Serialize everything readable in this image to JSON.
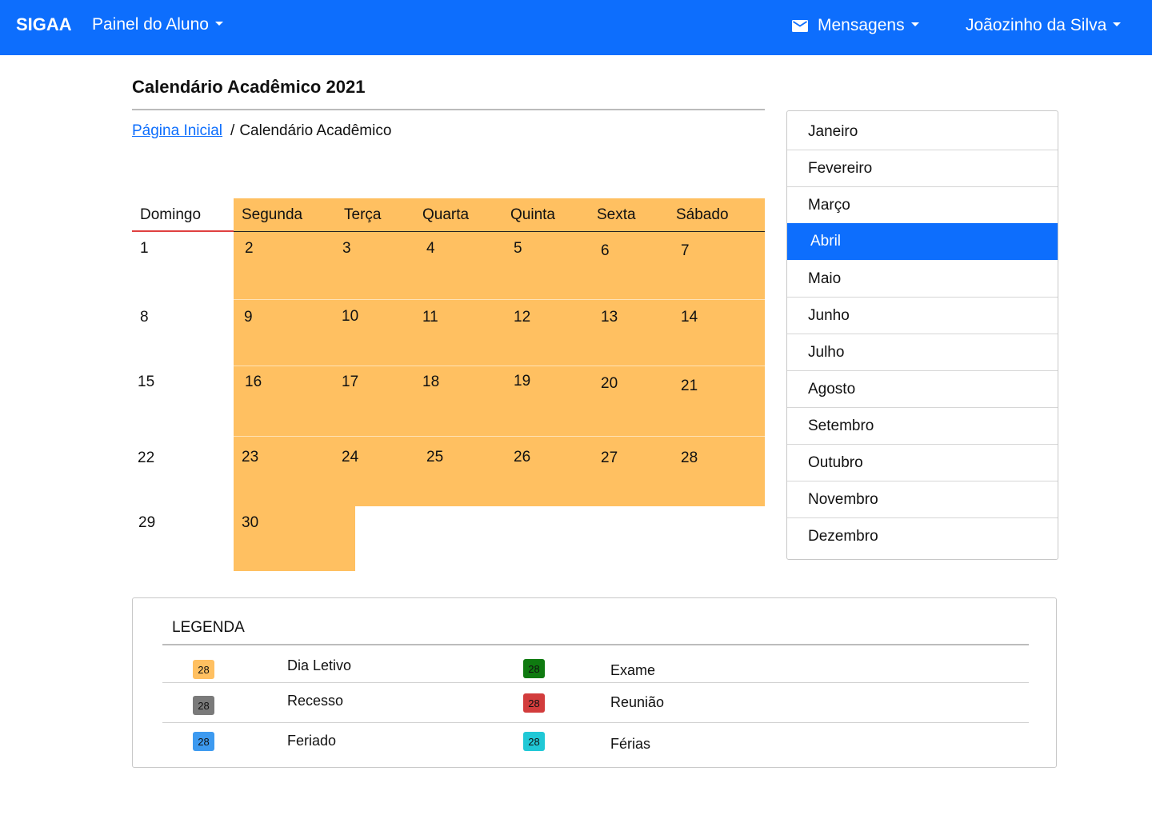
{
  "navbar": {
    "brand": "SIGAA",
    "menu_label": "Painel do Aluno",
    "messages_label": "Mensagens",
    "messages_icon": "envelope-icon",
    "user_name": "Joãozinho da Silva",
    "background_color": "#0d6efd"
  },
  "page": {
    "title": "Calendário Acadêmico 2021",
    "breadcrumb": {
      "home": "Página Inicial",
      "separator": "/",
      "current": "Calendário Acadêmico"
    }
  },
  "calendar": {
    "weekdays": [
      "Domingo",
      "Segunda",
      "Terça",
      "Quarta",
      "Quinta",
      "Sexta",
      "Sábado"
    ],
    "weeks": [
      [
        "1",
        "2",
        "3",
        "4",
        "5",
        "6",
        "7"
      ],
      [
        "8",
        "9",
        "10",
        "11",
        "12",
        "13",
        "14"
      ],
      [
        "15",
        "16",
        "17",
        "18",
        "19",
        "20",
        "21"
      ],
      [
        "22",
        "23",
        "24",
        "25",
        "26",
        "27",
        "28"
      ],
      [
        "29",
        "30"
      ]
    ],
    "school_day_color": "#ffc061"
  },
  "months": {
    "items": [
      "Janeiro",
      "Fevereiro",
      "Março",
      "Abril",
      "Maio",
      "Junho",
      "Julho",
      "Agosto",
      "Setembro",
      "Outubro",
      "Novembro",
      "Dezembro"
    ],
    "active": "Abril"
  },
  "legend": {
    "title": "LEGENDA",
    "items": [
      {
        "label": "Dia Letivo",
        "sample": "28",
        "color": "#ffc061"
      },
      {
        "label": "Exame",
        "sample": "28",
        "color": "#0f7a10"
      },
      {
        "label": "Recesso",
        "sample": "28",
        "color": "#7a7a7a"
      },
      {
        "label": "Reunião",
        "sample": "28",
        "color": "#d23c3c"
      },
      {
        "label": "Feriado",
        "sample": "28",
        "color": "#3d9af0"
      },
      {
        "label": "Férias",
        "sample": "28",
        "color": "#20c8d6"
      }
    ]
  }
}
